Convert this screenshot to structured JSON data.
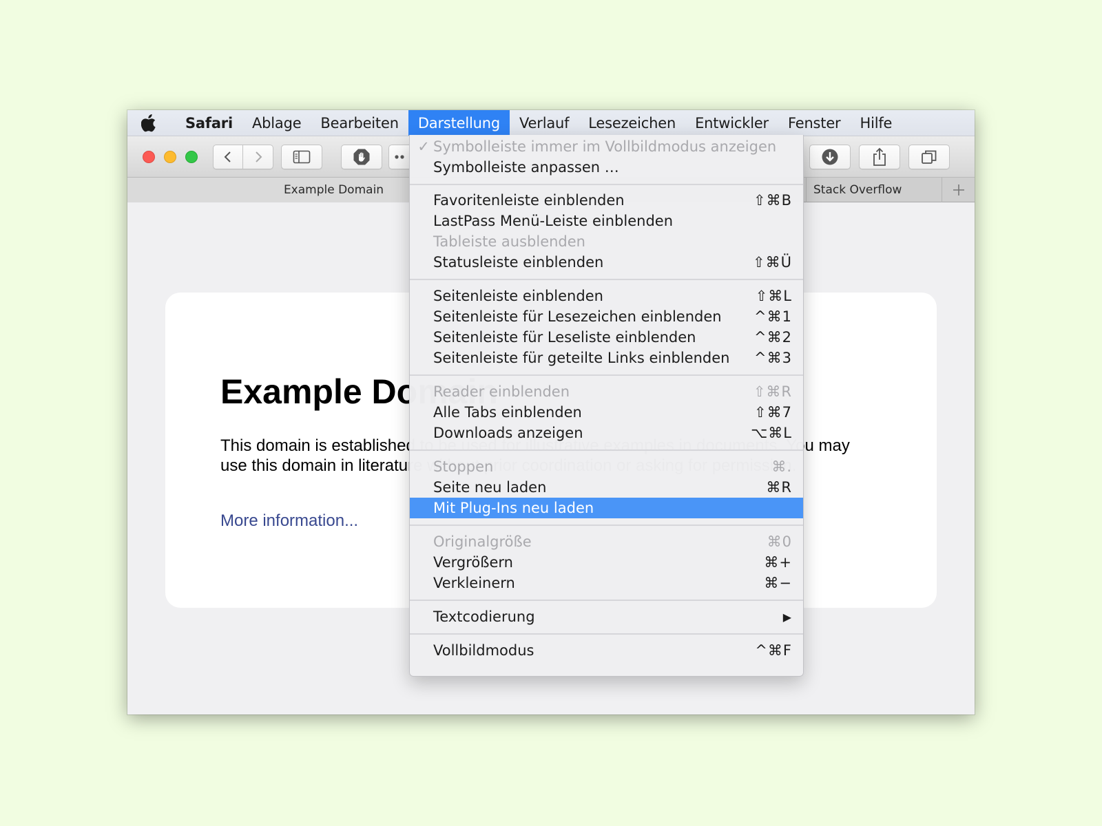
{
  "menubar": {
    "items": [
      "Safari",
      "Ablage",
      "Bearbeiten",
      "Darstellung",
      "Verlauf",
      "Lesezeichen",
      "Entwickler",
      "Fenster",
      "Hilfe"
    ],
    "active": "Darstellung"
  },
  "tabs": [
    "Example Domain",
    "Stack Overflow"
  ],
  "page": {
    "heading": "Example Domain",
    "paragraph": "This domain is established to be used for illustrative examples in documents. You may use this domain in literature without prior coordination or asking for permission.",
    "link": "More information..."
  },
  "menu": {
    "items": [
      {
        "label": "Symbolleiste immer im Vollbildmodus anzeigen",
        "shortcut": "",
        "disabled": true,
        "checked": true
      },
      {
        "label": "Symbolleiste anpassen …",
        "shortcut": ""
      },
      {
        "label": "Favoritenleiste einblenden",
        "shortcut": "⇧⌘B"
      },
      {
        "label": "LastPass Menü-Leiste einblenden",
        "shortcut": ""
      },
      {
        "label": "Tableiste ausblenden",
        "shortcut": "",
        "disabled": true
      },
      {
        "label": "Statusleiste einblenden",
        "shortcut": "⇧⌘Ü"
      },
      {
        "label": "Seitenleiste einblenden",
        "shortcut": "⇧⌘L"
      },
      {
        "label": "Seitenleiste für Lesezeichen einblenden",
        "shortcut": "^⌘1"
      },
      {
        "label": "Seitenleiste für Leseliste einblenden",
        "shortcut": "^⌘2"
      },
      {
        "label": "Seitenleiste für geteilte Links einblenden",
        "shortcut": "^⌘3"
      },
      {
        "label": "Reader einblenden",
        "shortcut": "⇧⌘R",
        "disabled": true
      },
      {
        "label": "Alle Tabs einblenden",
        "shortcut": "⇧⌘7"
      },
      {
        "label": "Downloads anzeigen",
        "shortcut": "⌥⌘L"
      },
      {
        "label": "Stoppen",
        "shortcut": "⌘.",
        "disabled": true
      },
      {
        "label": "Seite neu laden",
        "shortcut": "⌘R"
      },
      {
        "label": "Mit Plug-Ins neu laden",
        "shortcut": "",
        "highlighted": true
      },
      {
        "label": "Originalgröße",
        "shortcut": "⌘0",
        "disabled": true
      },
      {
        "label": "Vergrößern",
        "shortcut": "⌘+"
      },
      {
        "label": "Verkleinern",
        "shortcut": "⌘−"
      },
      {
        "label": "Textcodierung",
        "shortcut": "▶"
      },
      {
        "label": "Vollbildmodus",
        "shortcut": "^⌘F"
      }
    ]
  },
  "colors": {
    "background": "#f1fde1",
    "accent": "#2f82f4",
    "highlight": "#4a95f7",
    "link": "#38488f"
  }
}
